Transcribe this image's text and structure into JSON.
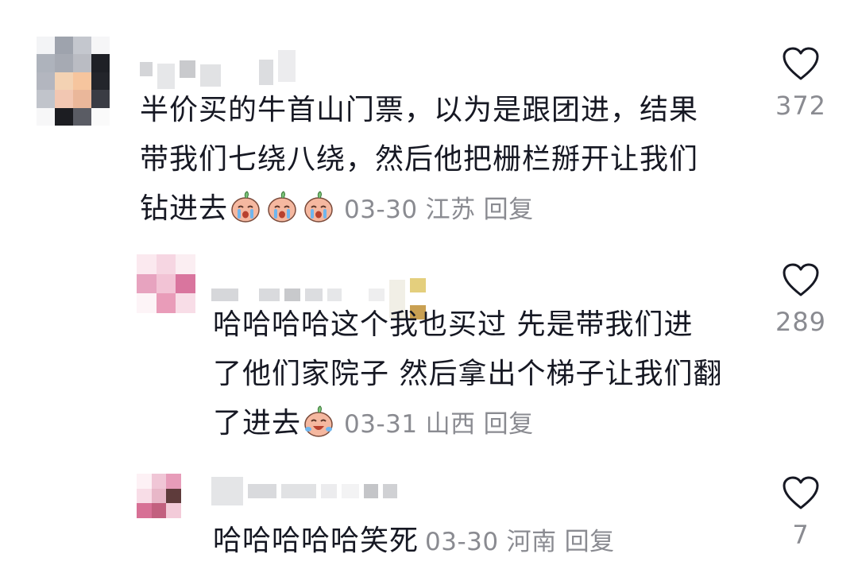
{
  "comments": [
    {
      "text_line1": "半价买的牛首山门票，以为是跟团进，结果",
      "text_line2": "带我们七绕八绕，然后他把栅栏掰开让我们",
      "text_line3": "钻进去",
      "date": "03-30",
      "location": "江苏",
      "reply_label": "回复",
      "like_count": "372",
      "emoji": "crying-face-emoji"
    },
    {
      "text_line1": "哈哈哈哈这个我也买过 先是带我们进",
      "text_line2": "了他们家院子 然后拿出个梯子让我们翻",
      "text_line3": "了进去",
      "date": "03-31",
      "location": "山西",
      "reply_label": "回复",
      "like_count": "289",
      "emoji": "laughing-crying-face-emoji"
    },
    {
      "text_line1": "哈哈哈哈哈笑死",
      "date": "03-30",
      "location": "河南",
      "reply_label": "回复",
      "like_count": "7"
    }
  ],
  "colors": {
    "text": "#161823",
    "meta": "#8a8b91",
    "heart_stroke": "#161823"
  }
}
